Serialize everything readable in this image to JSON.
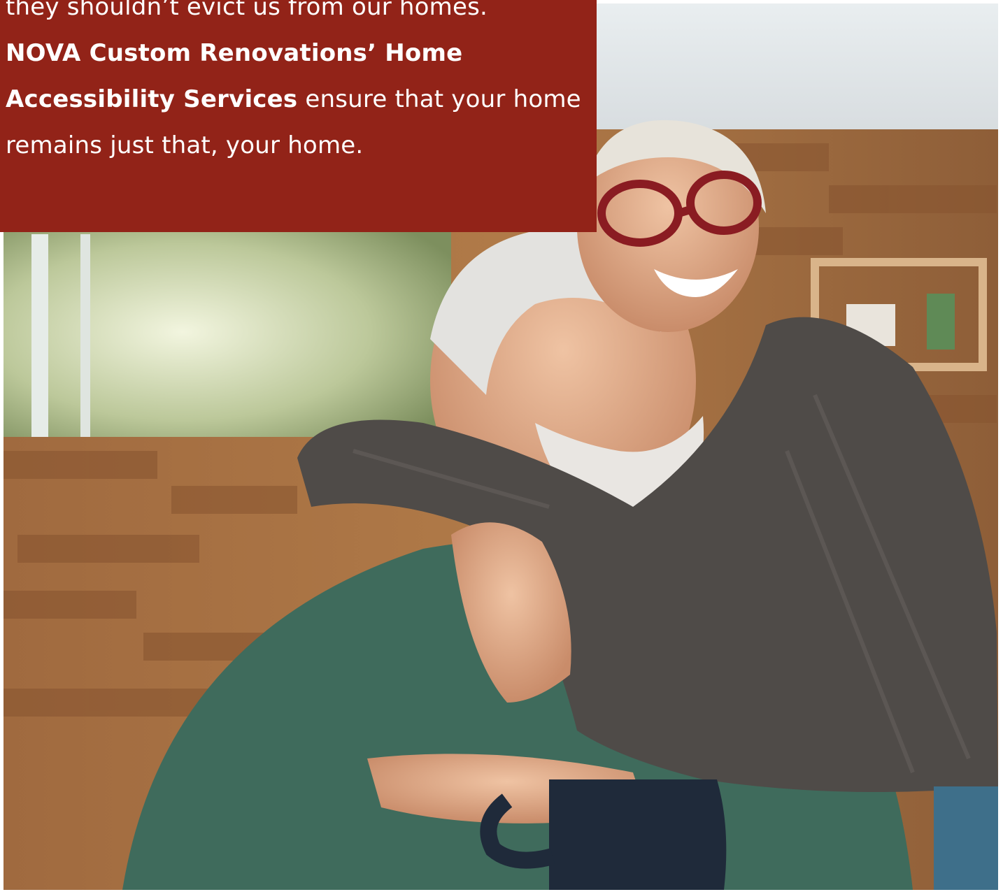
{
  "intro": {
    "line_partial": "they shouldn’t evict us from our homes.",
    "company_services_bold": "NOVA Custom Renovations’ Home Accessibility Services",
    "closing_text": " ensure that your home remains just that, your home."
  },
  "photo": {
    "subject": "older-couple-hug-photo"
  },
  "colors": {
    "card_bg": "#922318",
    "card_text": "#ffffff"
  }
}
